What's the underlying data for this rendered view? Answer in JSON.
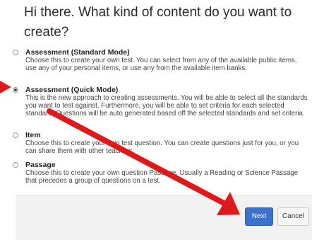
{
  "dialog": {
    "title": "Hi there. What kind of content do you want to create?"
  },
  "options": [
    {
      "title": "Assessment (Standard Mode)",
      "description": "Choose this to create your own test. You can select from any of the available public items, use any of your personal items, or use any from the available item banks.",
      "selected": false
    },
    {
      "title": "Assessment (Quick Mode)",
      "description": "This is the new approach to creating assessments. You will be able to select all the standards you want to test against. Furthermore, you will be able to set criteria for each selected standard. Questions will be auto generated based off the selected standards and set criteria.",
      "selected": true
    },
    {
      "title": "Item",
      "description": "Choose this to create your own test question. You can create questions just for you, or you can share them with other teachers.",
      "selected": false
    },
    {
      "title": "Passage",
      "description": "Choose this to create your own question Passage. Usually a Reading or Science Passage that precedes a group of questions on a test.",
      "selected": false
    }
  ],
  "buttons": {
    "next_label": "Next",
    "cancel_label": "Cancel"
  },
  "colors": {
    "accent": "#3c72c9",
    "annotation_arrow": "#e0181a"
  }
}
